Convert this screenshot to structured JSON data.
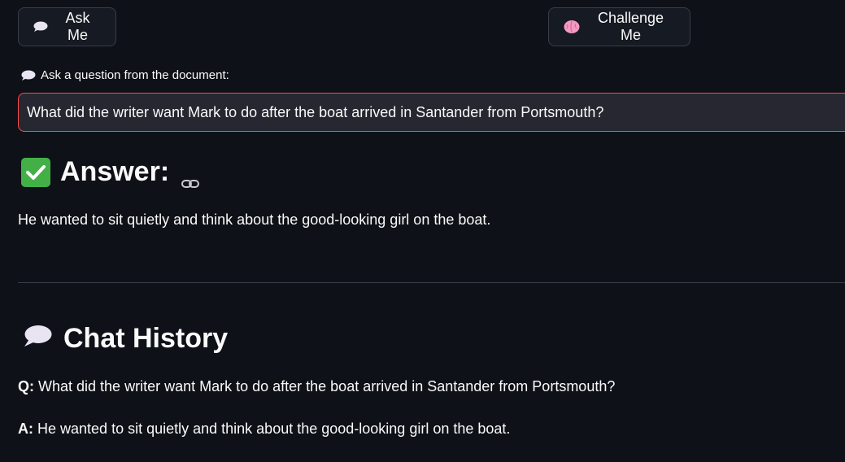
{
  "buttons": {
    "ask_label": "Ask Me",
    "challenge_label": "Challenge Me"
  },
  "question": {
    "label": "Ask a question from the document:",
    "value": "What did the writer want Mark to do after the boat arrived in Santander from Portsmouth?"
  },
  "answer": {
    "heading": "Answer:",
    "text": "He wanted to sit quietly and think about the good-looking girl on the boat."
  },
  "history": {
    "heading": "Chat History",
    "q_prefix": "Q:",
    "q_text": "What did the writer want Mark to do after the boat arrived in Santander from Portsmouth?",
    "a_prefix": "A:",
    "a_text": "He wanted to sit quietly and think about the good-looking girl on the boat."
  },
  "icons": {
    "ask": "speech-balloon-icon",
    "challenge": "brain-icon",
    "answer": "check-mark-icon",
    "anchor": "link-icon",
    "history": "speech-balloon-icon"
  },
  "colors": {
    "background": "#0e1117",
    "input_border": "#ff4b4b",
    "check_green": "#43b047"
  }
}
